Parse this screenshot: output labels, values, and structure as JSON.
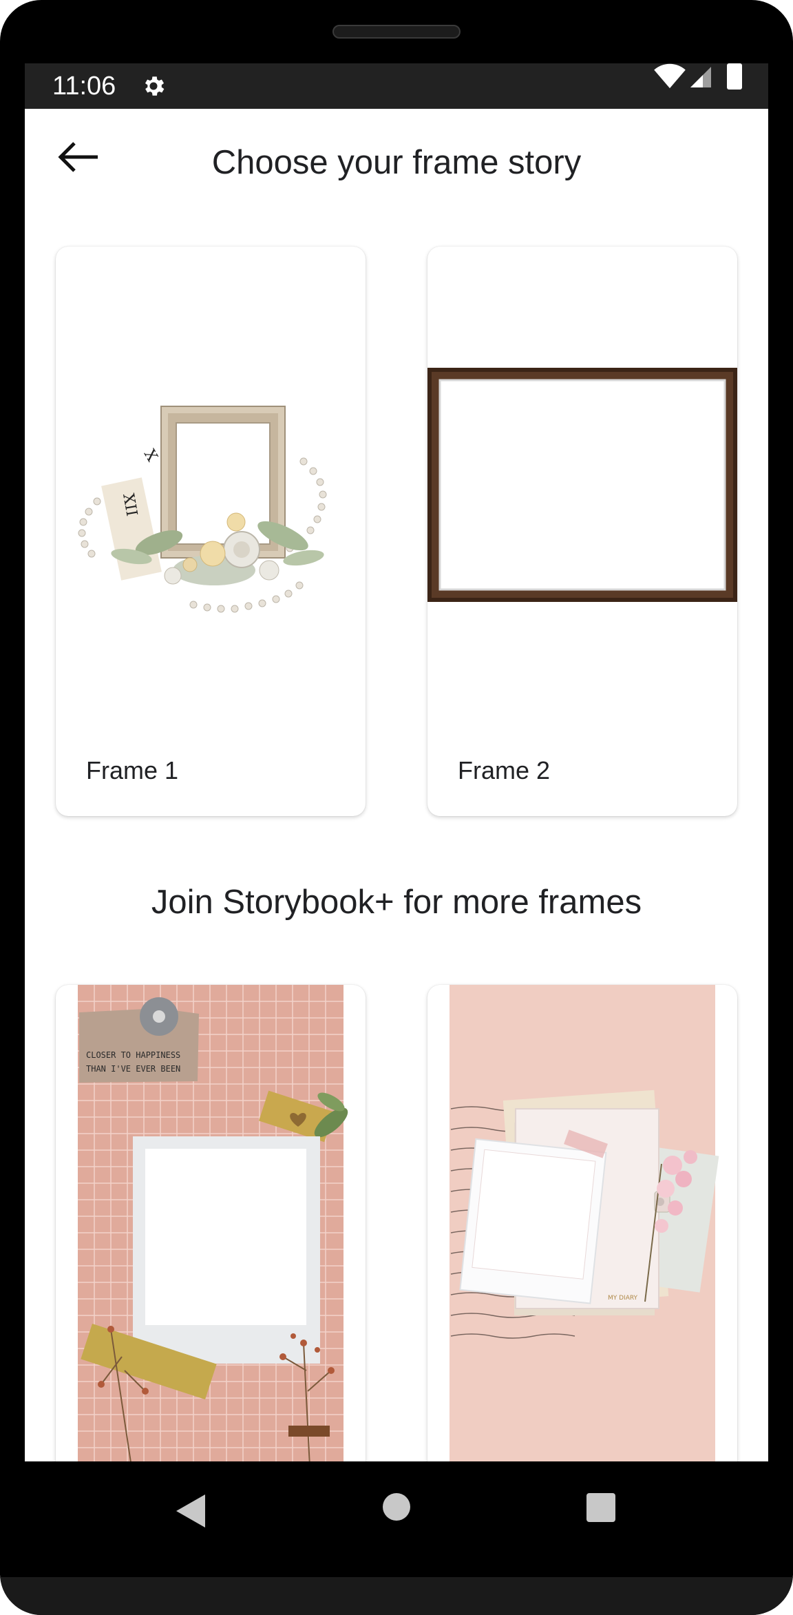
{
  "status_bar": {
    "time": "11:06"
  },
  "header": {
    "title": "Choose your frame story",
    "back_icon": "arrow-back-icon"
  },
  "frames": [
    {
      "label": "Frame 1"
    },
    {
      "label": "Frame 2"
    }
  ],
  "premium": {
    "title": "Join Storybook+ for more frames"
  },
  "premium_frames": [
    {
      "note_text": "CLOSER TO HAPPINESS THAN I'VE EVER BEEN"
    },
    {
      "note_text": "MY DIARY"
    }
  ],
  "nav": {
    "back_icon": "triangle-back-icon",
    "home_icon": "circle-home-icon",
    "recents_icon": "square-recents-icon"
  },
  "colors": {
    "status_bar": "#222222",
    "pink_bg": "#e0aa9b",
    "pink_bg_2": "#f2cfc5",
    "frame_wood": "#3b2416"
  }
}
